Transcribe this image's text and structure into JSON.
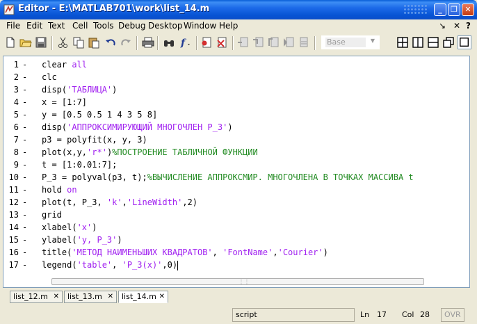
{
  "window": {
    "title": "Editor - E:\\MATLAB701\\work\\list_14.m",
    "controls": {
      "minimize": "_",
      "restore": "❐",
      "close": "✕"
    }
  },
  "menu": {
    "items": [
      "File",
      "Edit",
      "Text",
      "Cell",
      "Tools",
      "Debug",
      "Desktop",
      "Window",
      "Help"
    ],
    "dock_glyph": "↘",
    "close_glyph": "✕"
  },
  "toolbar": {
    "icons": [
      "new-file-icon",
      "open-folder-icon",
      "save-icon",
      "cut-icon",
      "copy-icon",
      "paste-icon",
      "undo-icon",
      "redo-icon",
      "print-icon",
      "find-icon",
      "function-icon",
      "set-breakpoint-icon",
      "clear-breakpoint-icon",
      "step-icon",
      "step-in-icon",
      "step-out-icon",
      "continue-icon",
      "exit-debug-icon"
    ],
    "stack_value": "Base",
    "layout_icons": [
      "tile-icon",
      "split-vertical-icon",
      "split-horizontal-icon",
      "float-icon",
      "maximize-icon"
    ]
  },
  "editor": {
    "line_numbers": [
      "1",
      "2",
      "3",
      "4",
      "5",
      "6",
      "7",
      "8",
      "9",
      "10",
      "11",
      "12",
      "13",
      "14",
      "15",
      "16",
      "17"
    ],
    "lines": [
      [
        {
          "t": "clear ",
          "c": ""
        },
        {
          "t": "all",
          "c": "str"
        }
      ],
      [
        {
          "t": "clc",
          "c": ""
        }
      ],
      [
        {
          "t": "disp(",
          "c": ""
        },
        {
          "t": "'ТАБЛИЦА'",
          "c": "str"
        },
        {
          "t": ")",
          "c": ""
        }
      ],
      [
        {
          "t": "x = [1:7]",
          "c": ""
        }
      ],
      [
        {
          "t": "y = [0.5 0.5 1 4 3 5 8]",
          "c": ""
        }
      ],
      [
        {
          "t": "disp(",
          "c": ""
        },
        {
          "t": "'АППРОКСИМИРУЮЩИЙ МНОГОЧЛЕН P_3'",
          "c": "str"
        },
        {
          "t": ")",
          "c": ""
        }
      ],
      [
        {
          "t": "p3 = polyfit(x, y, 3)",
          "c": ""
        }
      ],
      [
        {
          "t": "plot(x,y,",
          "c": ""
        },
        {
          "t": "'r*'",
          "c": "str"
        },
        {
          "t": ")",
          "c": ""
        },
        {
          "t": "%ПОСТРОЕНИЕ ТАБЛИЧНОЙ ФУНКЦИИ",
          "c": "cm"
        }
      ],
      [
        {
          "t": "t = [1:0.01:7];",
          "c": ""
        }
      ],
      [
        {
          "t": "P_3 = polyval(p3, t);",
          "c": ""
        },
        {
          "t": "%ВЫЧИСЛЕНИЕ АППРОКСМИР. МНОГОЧЛЕНА В ТОЧКАХ МАССИВА t",
          "c": "cm"
        }
      ],
      [
        {
          "t": "hold ",
          "c": ""
        },
        {
          "t": "on",
          "c": "str"
        }
      ],
      [
        {
          "t": "plot(t, P_3, ",
          "c": ""
        },
        {
          "t": "'k'",
          "c": "str"
        },
        {
          "t": ",",
          "c": ""
        },
        {
          "t": "'LineWidth'",
          "c": "str"
        },
        {
          "t": ",2)",
          "c": ""
        }
      ],
      [
        {
          "t": "grid",
          "c": ""
        }
      ],
      [
        {
          "t": "xlabel(",
          "c": ""
        },
        {
          "t": "'x'",
          "c": "str"
        },
        {
          "t": ")",
          "c": ""
        }
      ],
      [
        {
          "t": "ylabel(",
          "c": ""
        },
        {
          "t": "'y, P_3'",
          "c": "str"
        },
        {
          "t": ")",
          "c": ""
        }
      ],
      [
        {
          "t": "title(",
          "c": ""
        },
        {
          "t": "'МЕТОД НАИМЕНЬШИХ КВАДРАТОВ'",
          "c": "str"
        },
        {
          "t": ", ",
          "c": ""
        },
        {
          "t": "'FontName'",
          "c": "str"
        },
        {
          "t": ",",
          "c": ""
        },
        {
          "t": "'Courier'",
          "c": "str"
        },
        {
          "t": ")",
          "c": ""
        }
      ],
      [
        {
          "t": "legend(",
          "c": ""
        },
        {
          "t": "'table'",
          "c": "str"
        },
        {
          "t": ", ",
          "c": ""
        },
        {
          "t": "'P_3(x)'",
          "c": "str"
        },
        {
          "t": ",0)",
          "c": ""
        }
      ]
    ],
    "dash": "-"
  },
  "tabs": [
    {
      "label": "list_12.m",
      "close": "✕",
      "active": false
    },
    {
      "label": "list_13.m",
      "close": "✕",
      "active": false
    },
    {
      "label": "list_14.m",
      "close": "✕",
      "active": true
    }
  ],
  "status": {
    "mode": "script",
    "ln_label": "Ln",
    "ln_value": "17",
    "col_label": "Col",
    "col_value": "28",
    "ovr": "OVR"
  }
}
